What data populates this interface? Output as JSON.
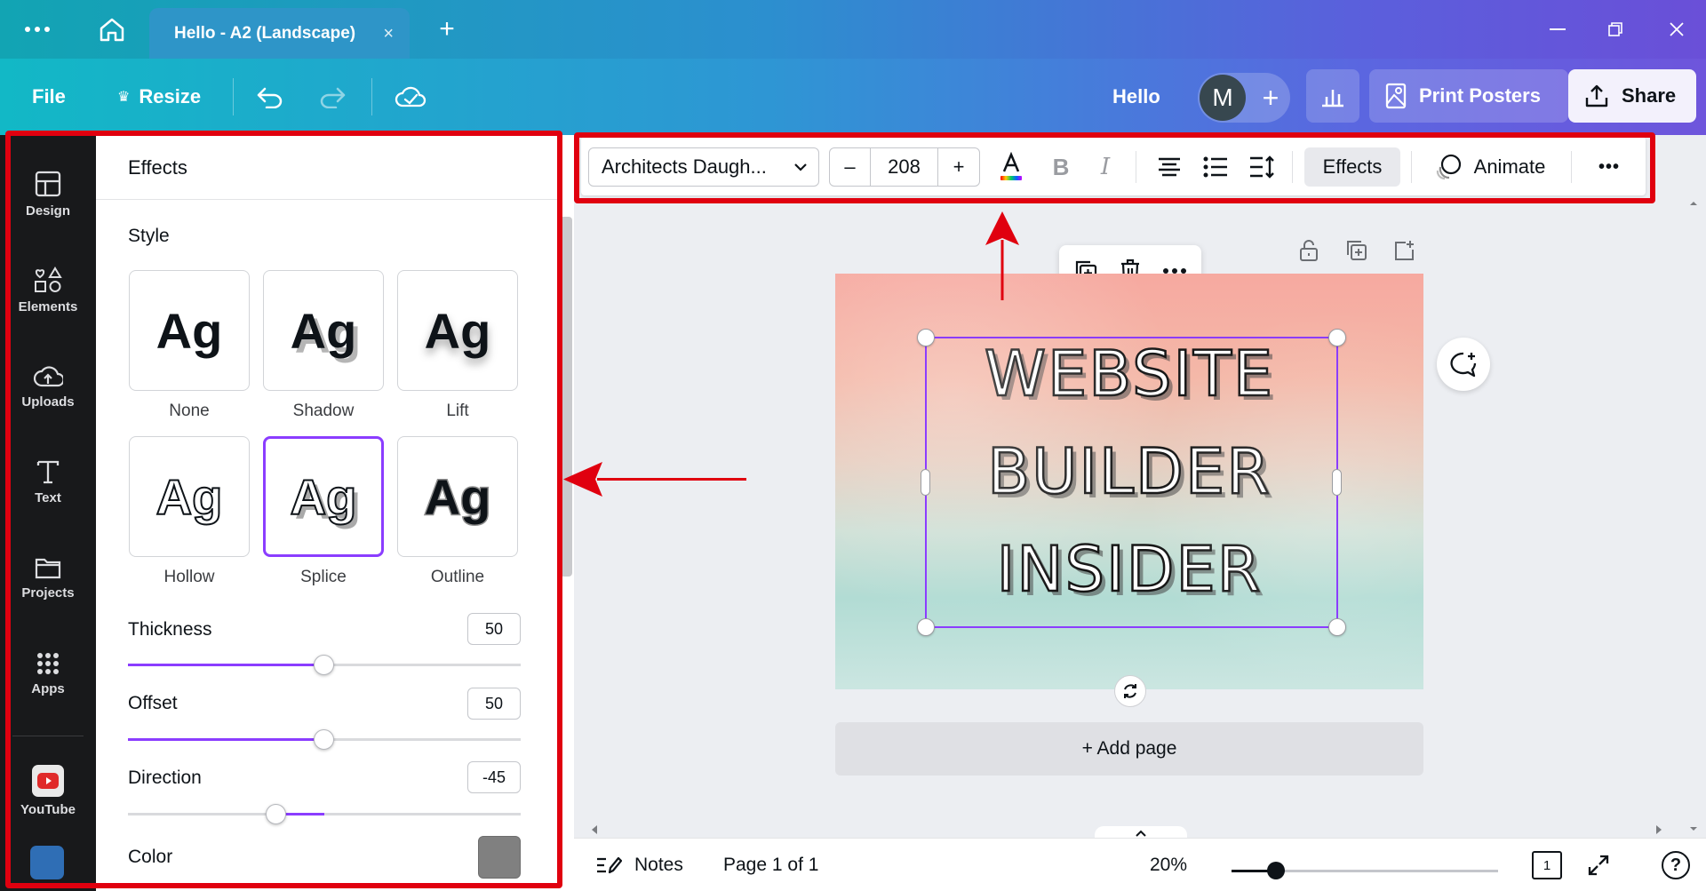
{
  "tabbar": {
    "tab_title": "Hello - A2 (Landscape)",
    "tab_close": "×",
    "new_tab": "+"
  },
  "header": {
    "file": "File",
    "resize": "Resize",
    "design_title": "Hello",
    "avatar_letter": "M",
    "add_member": "+",
    "print_posters": "Print Posters",
    "share": "Share"
  },
  "rail": {
    "items": [
      {
        "label": "Design",
        "icon": "layout-icon"
      },
      {
        "label": "Elements",
        "icon": "shapes-icon"
      },
      {
        "label": "Uploads",
        "icon": "cloud-upload-icon"
      },
      {
        "label": "Text",
        "icon": "text-icon"
      },
      {
        "label": "Projects",
        "icon": "folder-icon"
      },
      {
        "label": "Apps",
        "icon": "apps-grid-icon"
      },
      {
        "label": "YouTube",
        "icon": "youtube-icon"
      }
    ]
  },
  "effects_panel": {
    "title": "Effects",
    "style_label": "Style",
    "styles": [
      {
        "name": "None",
        "sample": "Ag"
      },
      {
        "name": "Shadow",
        "sample": "Ag"
      },
      {
        "name": "Lift",
        "sample": "Ag"
      },
      {
        "name": "Hollow",
        "sample": "Ag"
      },
      {
        "name": "Splice",
        "sample": "Ag",
        "selected": true
      },
      {
        "name": "Outline",
        "sample": "Ag"
      }
    ],
    "thickness": {
      "label": "Thickness",
      "value": "50"
    },
    "offset": {
      "label": "Offset",
      "value": "50"
    },
    "direction": {
      "label": "Direction",
      "value": "-45"
    },
    "color": {
      "label": "Color",
      "value": "#808080"
    }
  },
  "toolbar": {
    "font": "Architects Daugh...",
    "minus": "–",
    "font_size": "208",
    "plus": "+",
    "bold": "B",
    "italic": "I",
    "effects": "Effects",
    "animate": "Animate",
    "more": "•••"
  },
  "canvas": {
    "lines": [
      "WEBSITE",
      "BUILDER",
      "INSIDER"
    ],
    "add_page": "+ Add page"
  },
  "footer": {
    "notes": "Notes",
    "page_info": "Page 1 of 1",
    "zoom": "20%",
    "page_count": "1",
    "help": "?"
  },
  "colors": {
    "accent": "#8b3dff",
    "annotation": "#e0000f",
    "rail_bg": "#18191b"
  }
}
